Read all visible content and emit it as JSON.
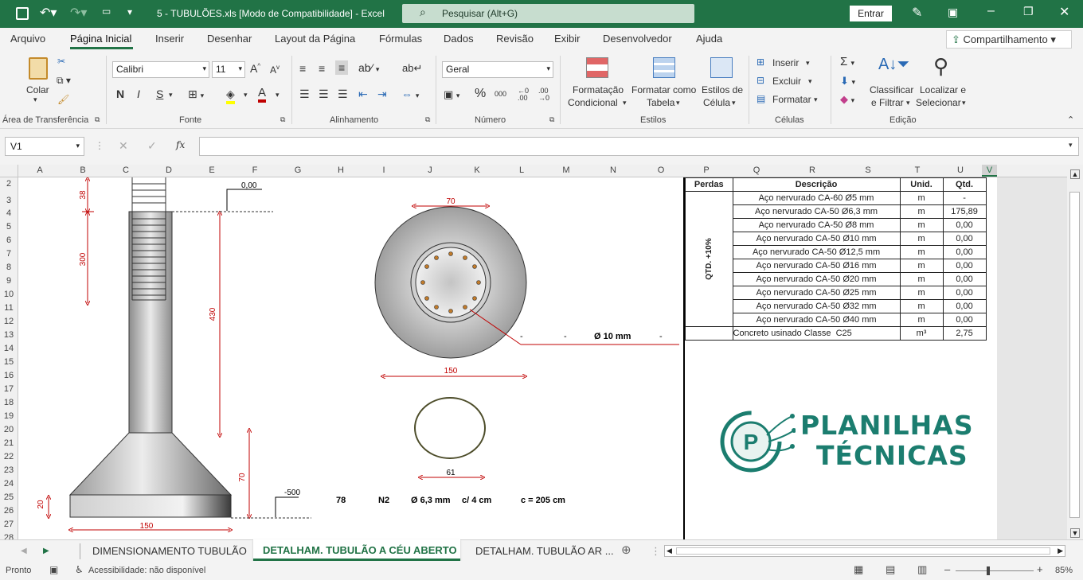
{
  "window": {
    "title": "5 - TUBULÕES.xls  [Modo de Compatibilidade]  -  Excel",
    "search_placeholder": "Pesquisar (Alt+G)",
    "signin": "Entrar"
  },
  "menu": [
    "Arquivo",
    "Página Inicial",
    "Inserir",
    "Desenhar",
    "Layout da Página",
    "Fórmulas",
    "Dados",
    "Revisão",
    "Exibir",
    "Desenvolvedor",
    "Ajuda"
  ],
  "share": "Compartilhamento",
  "ribbon": {
    "clipboard": {
      "paste": "Colar",
      "group": "Área de Transferência"
    },
    "font": {
      "name": "Calibri",
      "size": "11",
      "bold": "N",
      "italic": "I",
      "underline": "S",
      "group": "Fonte"
    },
    "alignment": {
      "group": "Alinhamento"
    },
    "number": {
      "format": "Geral",
      "percent": "%",
      "thousands": "000",
      "group": "Número"
    },
    "styles": {
      "cond_line1": "Formatação",
      "cond_line2": "Condicional",
      "table_line1": "Formatar como",
      "table_line2": "Tabela",
      "cell_line1": "Estilos de",
      "cell_line2": "Célula",
      "group": "Estilos"
    },
    "cells": {
      "insert": "Inserir",
      "delete": "Excluir",
      "format": "Formatar",
      "group": "Células"
    },
    "editing": {
      "sort_line1": "Classificar",
      "sort_line2": "e Filtrar",
      "find_line1": "Localizar e",
      "find_line2": "Selecionar",
      "group": "Edição"
    }
  },
  "formula_bar": {
    "name_box": "V1",
    "fx": "fx",
    "value": ""
  },
  "columns": [
    "A",
    "B",
    "C",
    "D",
    "E",
    "F",
    "G",
    "H",
    "I",
    "J",
    "K",
    "L",
    "M",
    "N",
    "O",
    "P",
    "Q",
    "R",
    "S",
    "T",
    "U",
    "V"
  ],
  "rows": [
    "2",
    "3",
    "4",
    "5",
    "6",
    "7",
    "8",
    "9",
    "10",
    "11",
    "12",
    "13",
    "14",
    "15",
    "16",
    "17",
    "18",
    "19",
    "20",
    "21",
    "22",
    "23",
    "24",
    "25",
    "26",
    "27",
    "28"
  ],
  "drawing": {
    "shaft_dims": {
      "d38": "38",
      "d300": "300",
      "d430": "430",
      "d70": "70",
      "d20": "20",
      "d150": "150",
      "level": "0,00",
      "level2": "-500"
    },
    "section": {
      "d70": "70",
      "d150": "150",
      "d61": "61",
      "bar_label": "Ø 10 mm",
      "dash1": "-",
      "dash2": "-",
      "dash3": "-"
    },
    "stirrup_row": {
      "qty": "78",
      "pos": "N2",
      "diam": "Ø 6,3 mm",
      "spacing": "c/ 4 cm",
      "length": "c = 205 cm"
    }
  },
  "quantities": {
    "headers": [
      "Perdas",
      "Descrição",
      "Unid.",
      "Qtd."
    ],
    "losses": "QTD. +10%",
    "rows": [
      {
        "desc": "Aço nervurado CA-60 Ø5 mm",
        "unit": "m",
        "qty": "-"
      },
      {
        "desc": "Aço nervurado CA-50 Ø6,3 mm",
        "unit": "m",
        "qty": "175,89"
      },
      {
        "desc": "Aço nervurado CA-50 Ø8 mm",
        "unit": "m",
        "qty": "0,00"
      },
      {
        "desc": "Aço nervurado CA-50 Ø10 mm",
        "unit": "m",
        "qty": "0,00"
      },
      {
        "desc": "Aço nervurado CA-50 Ø12,5 mm",
        "unit": "m",
        "qty": "0,00"
      },
      {
        "desc": "Aço nervurado CA-50 Ø16 mm",
        "unit": "m",
        "qty": "0,00"
      },
      {
        "desc": "Aço nervurado CA-50 Ø20 mm",
        "unit": "m",
        "qty": "0,00"
      },
      {
        "desc": "Aço nervurado CA-50 Ø25 mm",
        "unit": "m",
        "qty": "0,00"
      },
      {
        "desc": "Aço nervurado CA-50 Ø32 mm",
        "unit": "m",
        "qty": "0,00"
      },
      {
        "desc": "Aço nervurado CA-50 Ø40 mm",
        "unit": "m",
        "qty": "0,00"
      },
      {
        "desc": "Concreto usinado Classe",
        "grade": "C25",
        "unit": "m³",
        "qty": "2,75"
      }
    ]
  },
  "logo": {
    "line1": "PLANILHAS",
    "line2": "TÉCNICAS",
    "letter": "P",
    "color": "#1b7d6f"
  },
  "tabs": [
    "DIMENSIONAMENTO TUBULÃO",
    "DETALHAM. TUBULÃO A CÉU ABERTO",
    "DETALHAM. TUBULÃO AR ..."
  ],
  "status": {
    "ready": "Pronto",
    "accessibility": "Acessibilidade: não disponível",
    "zoom": "85%"
  },
  "colors": {
    "excel_green": "#217346",
    "accent_red": "#c00000"
  }
}
